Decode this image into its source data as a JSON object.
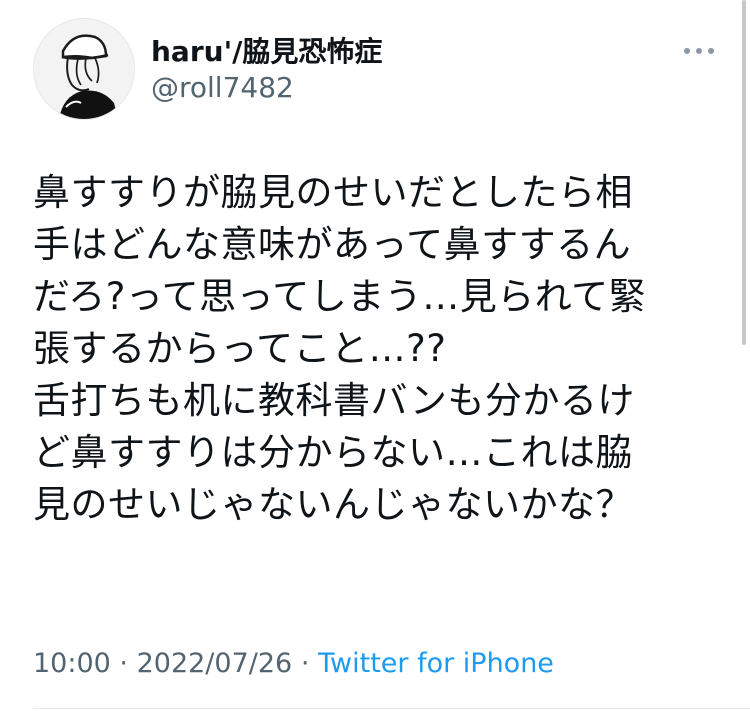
{
  "tweet": {
    "author": {
      "display_name": "haru'/脇見恐怖症",
      "handle": "@roll7482",
      "avatar_icon": "avatar-illustration-icon"
    },
    "more_icon": "more-dots-icon",
    "lines": [
      "鼻すすりが脇見のせいだとしたら相",
      "手はどんな意味があって鼻すするん",
      "だろ?って思ってしまう…見られて緊",
      "張するからってこと…??",
      "舌打ちも机に教科書バンも分かるけ",
      "ど鼻すすりは分からない…これは脇",
      "見のせいじゃないんじゃないかな？"
    ],
    "time": "10:00",
    "separator": "·",
    "date": "2022/07/26",
    "source": "Twitter for iPhone",
    "colors": {
      "text": "#0f1419",
      "secondary": "#536471",
      "link": "#1d9bf0"
    }
  }
}
